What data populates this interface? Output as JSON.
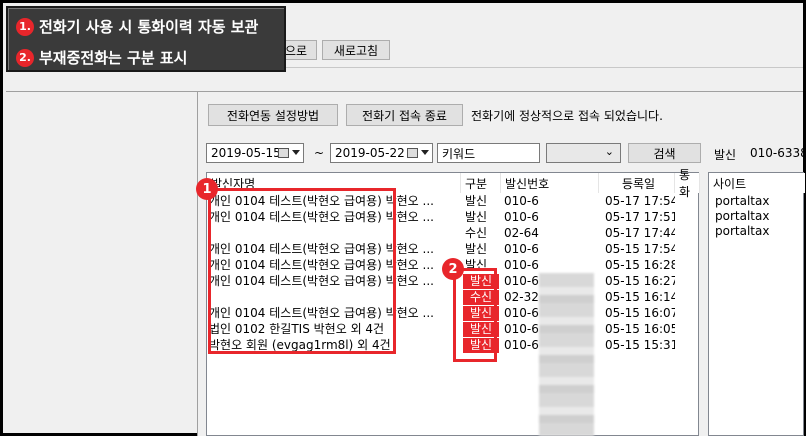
{
  "callout": {
    "item1_num": "1.",
    "item1_text": "전화기 사용 시 통화이력 자동 보관",
    "item2_num": "2.",
    "item2_text": "부재중전화는 구분 표시"
  },
  "toolbar": {
    "partial_label": "으로",
    "refresh_label": "새로고침"
  },
  "phone": {
    "guide_button": "전화연동 설정방법",
    "disconnect_button": "전화기 접속 종료",
    "status_text": "전화기에 정상적으로 접속 되었습니다."
  },
  "filter": {
    "date_from": "2019-05-15",
    "tilde": "~",
    "date_to": "2019-05-22",
    "keyword_placeholder": "키워드",
    "select_value": "",
    "search_button": "검색",
    "caller_label": "발신",
    "caller_number": "010-6338-"
  },
  "table": {
    "headers": [
      "발신자명",
      "구분",
      "발신번호",
      "등록일",
      "통화"
    ],
    "rows": [
      {
        "name": "개인 0104 테스트(박현오 급여용) 박현오 ...",
        "type": "발신",
        "number": "010-6",
        "date": "05-17 17:54",
        "missed": false
      },
      {
        "name": "개인 0104 테스트(박현오 급여용) 박현오 ...",
        "type": "발신",
        "number": "010-6",
        "date": "05-17 17:51",
        "missed": false
      },
      {
        "name": "",
        "type": "수신",
        "number": "02-64",
        "date": "05-17 17:44",
        "missed": false
      },
      {
        "name": "개인 0104 테스트(박현오 급여용) 박현오 ...",
        "type": "발신",
        "number": "010-6",
        "date": "05-15 17:54",
        "missed": false
      },
      {
        "name": "개인 0104 테스트(박현오 급여용) 박현오 ...",
        "type": "발신",
        "number": "010-6",
        "date": "05-15 16:28",
        "missed": false
      },
      {
        "name": "개인 0104 테스트(박현오 급여용) 박현오 ...",
        "type": "발신",
        "number": "010-6",
        "date": "05-15 16:27",
        "missed": true
      },
      {
        "name": "",
        "type": "수신",
        "number": "02-32",
        "date": "05-15 16:14",
        "missed": true
      },
      {
        "name": "개인 0104 테스트(박현오 급여용) 박현오 ...",
        "type": "발신",
        "number": "010-6",
        "date": "05-15 16:07",
        "missed": true
      },
      {
        "name": "법인 0102 한길TIS 박현오 외 4건",
        "type": "발신",
        "number": "010-6",
        "date": "05-15 16:05",
        "missed": true
      },
      {
        "name": "박현오 회원 (evgag1rm8l) 외 4건",
        "type": "발신",
        "number": "010-6",
        "date": "05-15 15:31",
        "missed": true
      }
    ]
  },
  "sites": {
    "header": "사이트",
    "items": [
      "portaltax",
      "portaltax",
      "portaltax"
    ]
  },
  "markers": {
    "one": "1",
    "two": "2"
  },
  "colors": {
    "accent_red": "#e8262b",
    "callout_bg": "#3a3a3a"
  }
}
